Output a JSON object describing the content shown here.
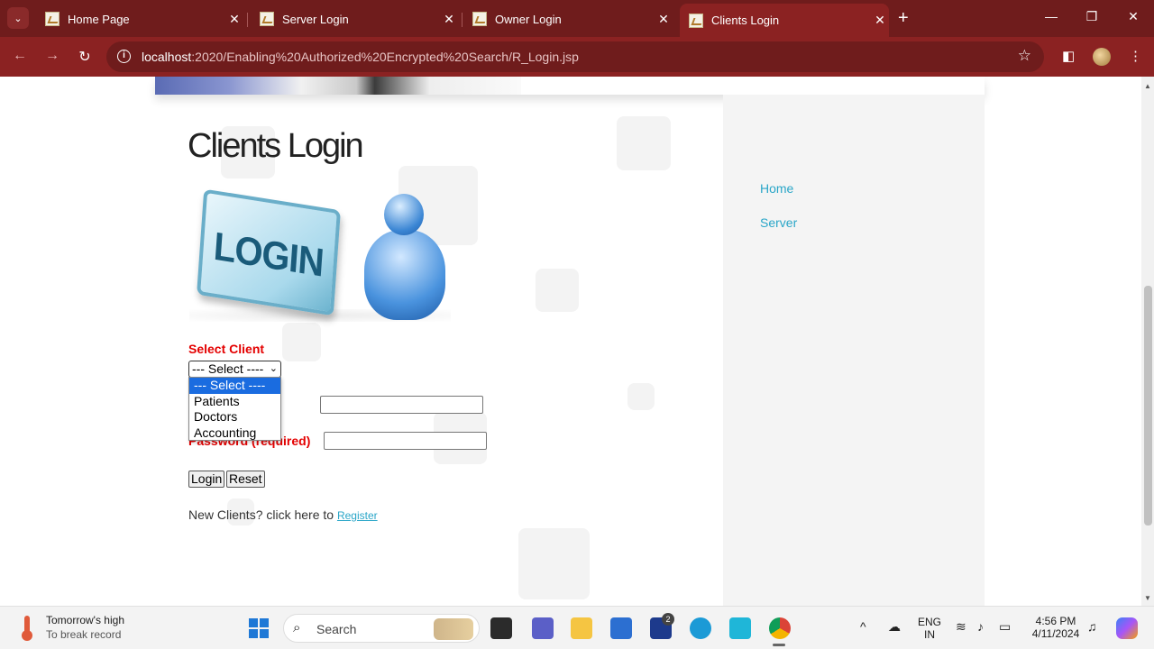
{
  "browser": {
    "tabs": [
      {
        "title": "Home Page",
        "active": false
      },
      {
        "title": "Server Login",
        "active": false
      },
      {
        "title": "Owner Login",
        "active": false
      },
      {
        "title": "Clients Login",
        "active": true
      }
    ],
    "url_host": "localhost",
    "url_rest": ":2020/Enabling%20Authorized%20Encrypted%20Search/R_Login.jsp"
  },
  "page": {
    "title": "Clients Login",
    "login_graphic_text": "LOGIN",
    "sidebar_links": [
      "Home",
      "Server"
    ],
    "form": {
      "select_label": "Select Client",
      "select_value": "--- Select ----",
      "options": [
        "--- Select ----",
        "Patients",
        "Doctors",
        "Accounting"
      ],
      "name_label_tail": ")",
      "password_label": "Password (required)",
      "login_button": "Login",
      "reset_button": "Reset"
    },
    "register_prefix": "New Clients? click here to",
    "register_link": "Register"
  },
  "taskbar": {
    "weather_title": "Tomorrow's high",
    "weather_sub": "To break record",
    "search_placeholder": "Search",
    "lang_line1": "ENG",
    "lang_line2": "IN",
    "time": "4:56 PM",
    "date": "4/11/2024",
    "badge_count": "2"
  },
  "colors": {
    "browser_frame": "#8b2222",
    "label_red": "#e40000",
    "link_blue": "#2aa6c8",
    "dropdown_highlight": "#1a6ce0"
  }
}
